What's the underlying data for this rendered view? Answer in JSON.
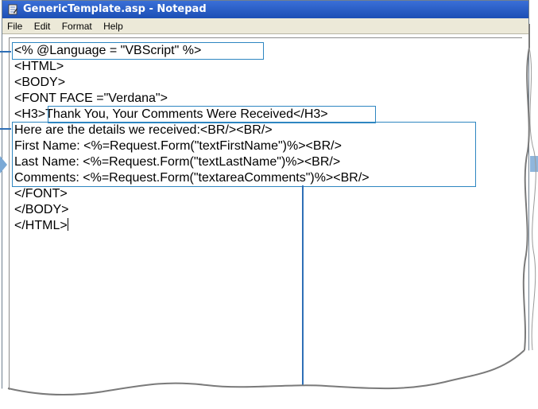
{
  "window": {
    "title": "GenericTemplate.asp - Notepad"
  },
  "menu": {
    "items": [
      "File",
      "Edit",
      "Format",
      "Help"
    ]
  },
  "code": {
    "lines": [
      "<% @Language = \"VBScript\" %>",
      "<HTML>",
      "<BODY>",
      "<FONT FACE =\"Verdana\">",
      "<H3>Thank You, Your Comments Were Received</H3>",
      "Here are the details we received:<BR/><BR/>",
      "First Name: <%=Request.Form(\"textFirstName\")%><BR/>",
      "Last Name: <%=Request.Form(\"textLastName\")%><BR/>",
      "Comments: <%=Request.Form(\"textareaComments\")%><BR/>",
      "</FONT>",
      "</BODY>",
      "</HTML>"
    ]
  },
  "colors": {
    "highlight": "#2e86c1",
    "titlebar": "#1c4fb5"
  },
  "icons": {
    "title": "notepad-icon",
    "arrow_left": "callout-arrow-icon",
    "arrow_right": "callout-arrow-icon"
  }
}
